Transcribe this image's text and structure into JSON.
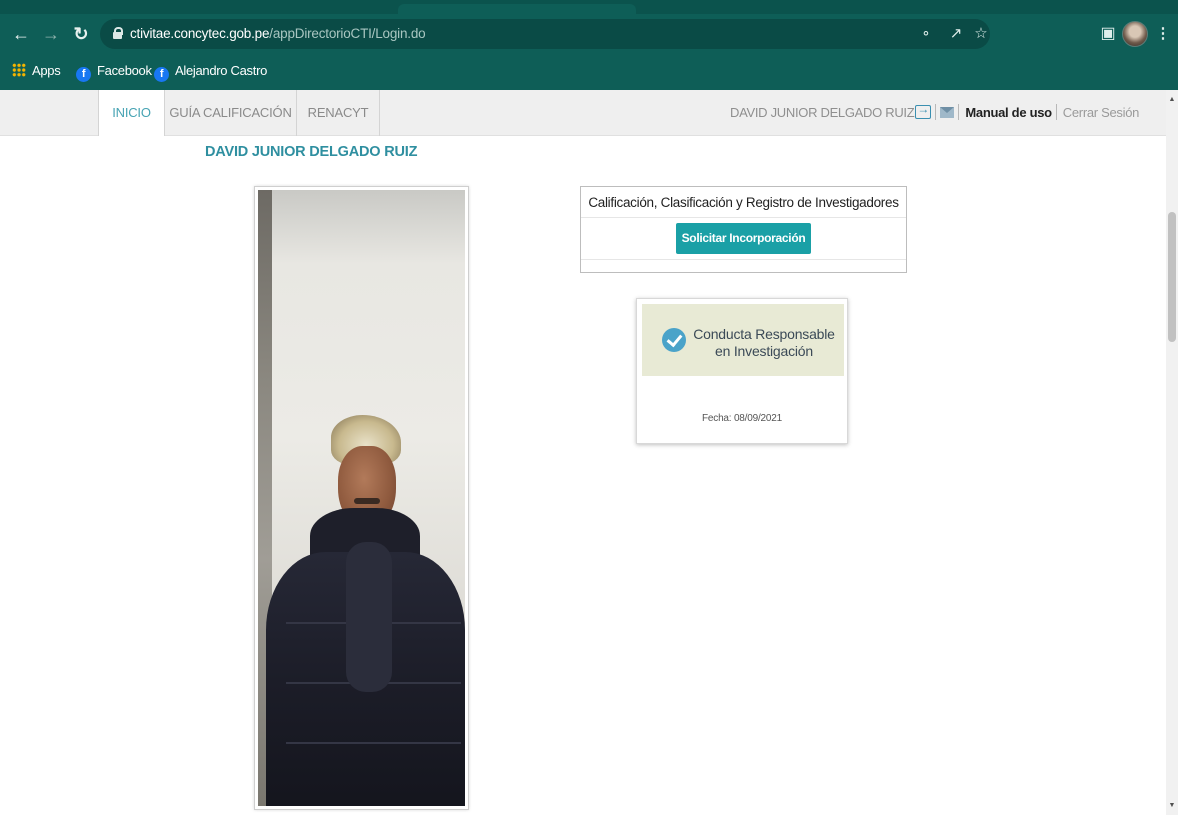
{
  "browser": {
    "url_domain": "ctivitae.concytec.gob.pe",
    "url_path": "/appDirectorioCTI/Login.do",
    "bookmarks": [
      {
        "label": "Apps",
        "icon": "apps-grid-icon"
      },
      {
        "label": "Facebook",
        "icon": "facebook-icon"
      },
      {
        "label": "Alejandro Castro",
        "icon": "facebook-icon"
      }
    ],
    "toolbar_icons": [
      "back-icon",
      "forward-icon",
      "reload-icon",
      "key-icon",
      "share-icon",
      "star-icon",
      "sidepanel-icon",
      "profile-avatar",
      "menu-icon"
    ]
  },
  "nav": {
    "tabs": [
      {
        "label": "INICIO",
        "active": true
      },
      {
        "label": "GUÍA CALIFICACIÓN",
        "active": false
      },
      {
        "label": "RENACYT",
        "active": false
      }
    ],
    "user_name": "DAVID JUNIOR DELGADO RUIZ",
    "manual_label": "Manual de uso",
    "logout_label": "Cerrar Sesión"
  },
  "profile": {
    "full_name": "DAVID JUNIOR DELGADO RUIZ"
  },
  "certification": {
    "title": "Calificación, Clasificación y Registro de Investigadores",
    "button_label": "Solicitar Incorporación"
  },
  "badge": {
    "line1": "Conducta Responsable",
    "line2": "en Investigación",
    "date_text": "Fecha: 08/09/2021"
  },
  "colors": {
    "chrome": "#0e5e57",
    "accent": "#46a3b3",
    "button": "#1aa0a6",
    "name": "#2f8fa0"
  }
}
